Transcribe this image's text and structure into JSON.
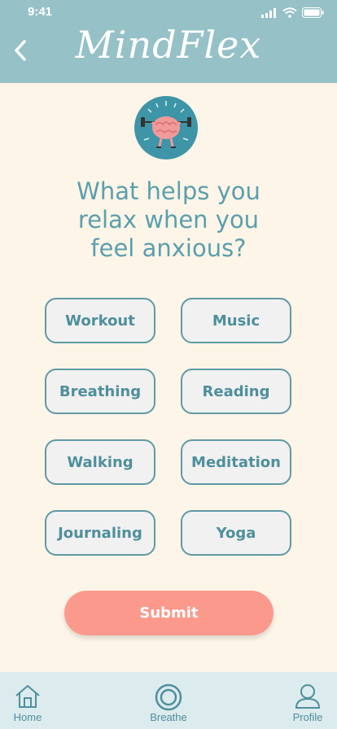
{
  "status_bar": {
    "time": "9:41"
  },
  "header": {
    "title": "MindFlex"
  },
  "question": {
    "line1": "What helps you",
    "line2": "relax when you",
    "line3": "feel anxious?"
  },
  "options": [
    "Workout",
    "Music",
    "Breathing",
    "Reading",
    "Walking",
    "Meditation",
    "Journaling",
    "Yoga"
  ],
  "submit_label": "Submit",
  "tabs": [
    {
      "label": "Home",
      "icon": "home-icon"
    },
    {
      "label": "Breathe",
      "icon": "breathe-icon"
    },
    {
      "label": "Profile",
      "icon": "profile-icon"
    }
  ],
  "colors": {
    "header": "#95c1c7",
    "background": "#fdf5e7",
    "accent": "#5a9fae",
    "submit": "#fb9a8c",
    "tabbar": "#dcebed"
  }
}
